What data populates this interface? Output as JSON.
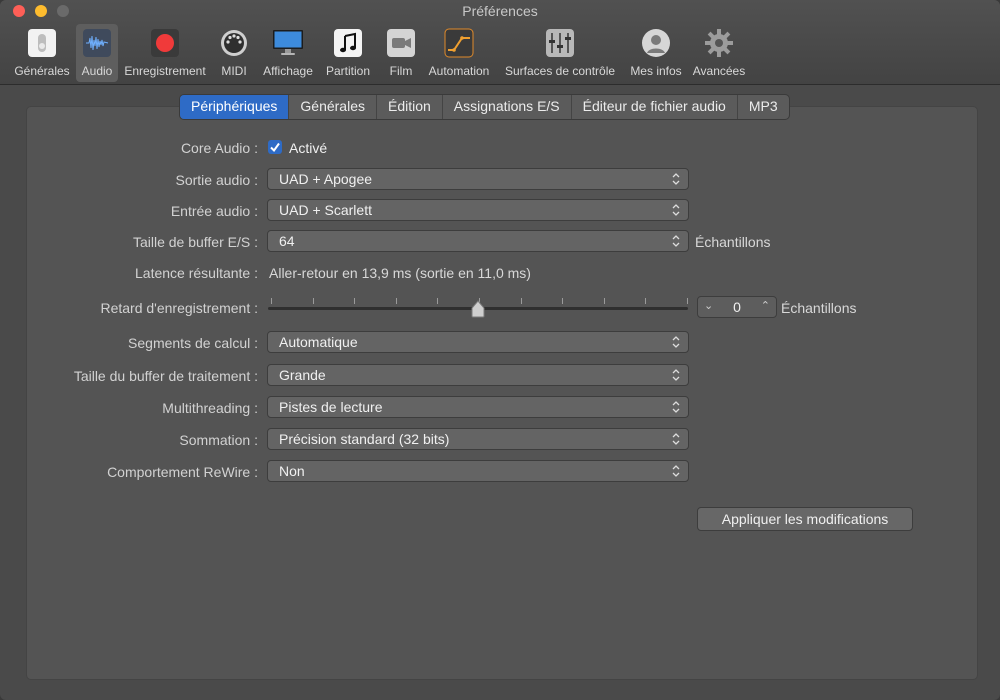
{
  "window": {
    "title": "Préférences"
  },
  "toolbar": {
    "items": [
      {
        "label": "Générales",
        "icon": "general-switch-icon"
      },
      {
        "label": "Audio",
        "icon": "audio-waveform-icon",
        "selected": true
      },
      {
        "label": "Enregistrement",
        "icon": "record-icon"
      },
      {
        "label": "MIDI",
        "icon": "midi-port-icon"
      },
      {
        "label": "Affichage",
        "icon": "display-monitor-icon"
      },
      {
        "label": "Partition",
        "icon": "music-note-icon"
      },
      {
        "label": "Film",
        "icon": "film-camera-icon"
      },
      {
        "label": "Automation",
        "icon": "automation-curve-icon"
      },
      {
        "label": "Surfaces de contrôle",
        "icon": "control-surface-icon"
      },
      {
        "label": "Mes infos",
        "icon": "user-icon"
      },
      {
        "label": "Avancées",
        "icon": "gear-icon"
      }
    ]
  },
  "tabs": [
    "Périphériques",
    "Générales",
    "Édition",
    "Assignations E/S",
    "Éditeur de fichier audio",
    "MP3"
  ],
  "active_tab": "Périphériques",
  "form": {
    "core_audio": {
      "label": "Core Audio :",
      "checkbox_label": "Activé",
      "checked": true
    },
    "output": {
      "label": "Sortie audio :",
      "value": "UAD + Apogee"
    },
    "input": {
      "label": "Entrée audio :",
      "value": "UAD + Scarlett"
    },
    "buffer": {
      "label": "Taille de buffer E/S :",
      "value": "64",
      "unit": "Échantillons"
    },
    "latency": {
      "label": "Latence résultante :",
      "value": "Aller-retour en 13,9 ms (sortie en 11,0 ms)"
    },
    "record_delay": {
      "label": "Retard d'enregistrement :",
      "value": "0",
      "unit": "Échantillons",
      "slider_fraction": 0.5
    },
    "segments": {
      "label": "Segments de calcul :",
      "value": "Automatique"
    },
    "process_buffer": {
      "label": "Taille du buffer de traitement :",
      "value": "Grande"
    },
    "multithreading": {
      "label": "Multithreading :",
      "value": "Pistes de lecture"
    },
    "summing": {
      "label": "Sommation :",
      "value": "Précision standard (32 bits)"
    },
    "rewire": {
      "label": "Comportement ReWire :",
      "value": "Non"
    }
  },
  "apply_button": "Appliquer les modifications",
  "colors": {
    "accent": "#2e6bc6",
    "background": "#4a4a4a",
    "panel": "#545454"
  }
}
